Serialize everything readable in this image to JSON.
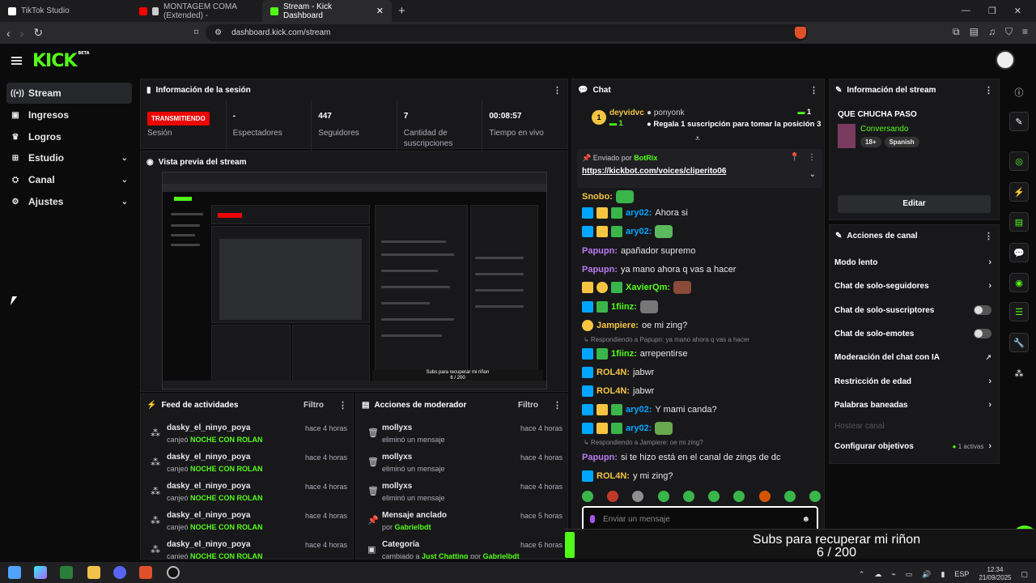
{
  "browser": {
    "tabs": [
      {
        "label": "TikTok Studio",
        "active": false,
        "icon": "tiktok-icon"
      },
      {
        "label": "MONTAGEM COMA (Extended) -",
        "active": false,
        "icon": "youtube-icon"
      },
      {
        "label": "Stream - Kick Dashboard",
        "active": true,
        "icon": "kick-icon"
      }
    ],
    "url": "dashboard.kick.com/stream"
  },
  "app": {
    "logo": "KICK",
    "logo_sup": "BETA",
    "accent": "#53fc18"
  },
  "sidebar": {
    "items": [
      {
        "label": "Stream",
        "icon": "broadcast-icon",
        "active": true,
        "expandable": false
      },
      {
        "label": "Ingresos",
        "icon": "money-icon",
        "active": false,
        "expandable": false
      },
      {
        "label": "Logros",
        "icon": "trophy-icon",
        "active": false,
        "expandable": false
      },
      {
        "label": "Estudio",
        "icon": "studio-icon",
        "active": false,
        "expandable": true
      },
      {
        "label": "Canal",
        "icon": "channel-icon",
        "active": false,
        "expandable": true
      },
      {
        "label": "Ajustes",
        "icon": "gear-icon",
        "active": false,
        "expandable": true
      }
    ]
  },
  "session": {
    "title": "Información de la sesión",
    "live_badge": "TRANSMITIENDO",
    "cells": [
      {
        "value": "",
        "label": "Sesión"
      },
      {
        "value": "-",
        "label": "Espectadores"
      },
      {
        "value": "447",
        "label": "Seguidores"
      },
      {
        "value": "7",
        "label": "Cantidad de suscripciones"
      },
      {
        "value": "00:08:57",
        "label": "Tiempo en vivo"
      }
    ]
  },
  "preview": {
    "title": "Vista previa del stream",
    "overlay_line1": "Subs para recuperar mi riñon",
    "overlay_line2": "6 / 200"
  },
  "feed": {
    "title": "Feed de actividades",
    "filter": "Filtro",
    "items": [
      {
        "user": "dasky_el_ninyo_poya",
        "action": "canjeó",
        "reward": "NOCHE CON ROLAN",
        "time": "hace 4 horas"
      },
      {
        "user": "dasky_el_ninyo_poya",
        "action": "canjeó",
        "reward": "NOCHE CON ROLAN",
        "time": "hace 4 horas"
      },
      {
        "user": "dasky_el_ninyo_poya",
        "action": "canjeó",
        "reward": "NOCHE CON ROLAN",
        "time": "hace 4 horas"
      },
      {
        "user": "dasky_el_ninyo_poya",
        "action": "canjeó",
        "reward": "NOCHE CON ROLAN",
        "time": "hace 4 horas"
      },
      {
        "user": "dasky_el_ninyo_poya",
        "action": "canjeó",
        "reward": "NOCHE CON ROLAN",
        "time": "hace 4 horas"
      }
    ]
  },
  "mod": {
    "title": "Acciones de moderador",
    "filter": "Filtro",
    "items": [
      {
        "title": "mollyxs",
        "desc": "eliminó un mensaje",
        "time": "hace 4 horas",
        "icon": "trash-icon"
      },
      {
        "title": "mollyxs",
        "desc": "eliminó un mensaje",
        "time": "hace 4 horas",
        "icon": "trash-icon"
      },
      {
        "title": "mollyxs",
        "desc": "eliminó un mensaje",
        "time": "hace 4 horas",
        "icon": "trash-icon"
      },
      {
        "title": "Mensaje anclado",
        "desc": "por",
        "who": "Gabrielbdt",
        "time": "hace 5 horas",
        "icon": "pin-icon"
      },
      {
        "title": "Categoría",
        "desc": "cambiado a",
        "who": "Just Chatting",
        "by": "por",
        "who2": "Gabrielbdt",
        "time": "hace 6 horas",
        "icon": "category-icon"
      }
    ]
  },
  "chat": {
    "title": "Chat",
    "sub_gift": {
      "user": "deyvidvc",
      "count": "1",
      "target": "ponyonk",
      "target_count": "1",
      "text": "Regala 1 suscripción para tomar la posición 3"
    },
    "pinned": {
      "by_label": "Enviado por",
      "by": "BotRix",
      "link": "https://kickbot.com/voices/cliperito06"
    },
    "messages": [
      {
        "user": "Snobo",
        "text": "",
        "color": "#f5c542",
        "badges": [],
        "emote": "#3ab54a"
      },
      {
        "user": "ary02",
        "text": "Ahora si",
        "color": "#00a6ff",
        "badges": [
          "mod",
          "crown",
          "sub"
        ]
      },
      {
        "user": "ary02",
        "text": "",
        "color": "#00a6ff",
        "badges": [
          "mod",
          "crown",
          "sub"
        ],
        "emote": "#5cb85c"
      },
      {
        "user": "Papupn",
        "text": "apañador supremo",
        "color": "#b97bf0",
        "badges": []
      },
      {
        "user": "Papupn",
        "text": "ya mano ahora q vas a hacer",
        "color": "#b97bf0",
        "badges": []
      },
      {
        "user": "XavierQm",
        "text": "",
        "color": "#53fc18",
        "badges": [
          "crown",
          "coin",
          "sub"
        ],
        "emote": "#8a4b3a"
      },
      {
        "user": "1fiinz",
        "text": "",
        "color": "#53fc18",
        "badges": [
          "mod",
          "sub"
        ],
        "emote": "#777777"
      },
      {
        "user": "Jampiere",
        "text": "oe mi zing?",
        "color": "#f5c542",
        "badges": [
          "coin"
        ]
      },
      {
        "reply": "Respondiendo a Papupn: ya mano ahora q vas a hacer"
      },
      {
        "user": "1fiinz",
        "text": "arrepentirse",
        "color": "#53fc18",
        "badges": [
          "mod",
          "sub"
        ]
      },
      {
        "user": "ROL4N",
        "text": "jabwr",
        "color": "#f5c542",
        "badges": [
          "mod"
        ]
      },
      {
        "user": "ROL4N",
        "text": "jabwr",
        "color": "#f5c542",
        "badges": [
          "mod"
        ]
      },
      {
        "user": "ary02",
        "text": "Y mami canda?",
        "color": "#00a6ff",
        "badges": [
          "mod",
          "crown",
          "sub"
        ]
      },
      {
        "user": "ary02",
        "text": "",
        "color": "#00a6ff",
        "badges": [
          "mod",
          "crown",
          "sub"
        ],
        "emote": "#6aa84f"
      },
      {
        "reply": "Respondiendo a Jampiere: oe mi zing?"
      },
      {
        "user": "Papupn",
        "text": "si te hizo está en el canal de zings de dc",
        "color": "#b97bf0",
        "badges": []
      },
      {
        "user": "ROL4N",
        "text": "y mi zing?",
        "color": "#f5c542",
        "badges": [
          "mod"
        ]
      }
    ],
    "input_placeholder": "Enviar un mensaje"
  },
  "stream_info": {
    "title": "Información del stream",
    "stream_title": "QUE CHUCHA PASO",
    "category": "Conversando",
    "tags": [
      "18+",
      "Spanish"
    ],
    "edit_button": "Editar"
  },
  "channel_actions": {
    "title": "Acciones de canal",
    "items": [
      {
        "label": "Modo lento",
        "kind": "chevron"
      },
      {
        "label": "Chat de solo-seguidores",
        "kind": "chevron"
      },
      {
        "label": "Chat de solo-suscriptores",
        "kind": "toggle"
      },
      {
        "label": "Chat de solo-emotes",
        "kind": "toggle"
      },
      {
        "label": "Moderación del chat con IA",
        "kind": "external"
      },
      {
        "label": "Restricción de edad",
        "kind": "chevron"
      },
      {
        "label": "Palabras baneadas",
        "kind": "chevron"
      },
      {
        "label": "Hostear canal",
        "kind": "disabled"
      },
      {
        "label": "Configurar objetivos",
        "kind": "chevron",
        "extra": "1 activas"
      }
    ]
  },
  "overlay": {
    "line1": "Subs para recuperar mi riñon",
    "line2": "6 / 200"
  },
  "taskbar": {
    "lang": "ESP",
    "time": "12:34",
    "date": "21/09/2025"
  }
}
